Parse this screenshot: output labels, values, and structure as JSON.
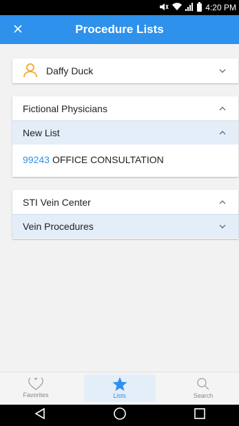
{
  "status_bar": {
    "time": "4:20 PM"
  },
  "header": {
    "title": "Procedure Lists"
  },
  "patient": {
    "name": "Daffy Duck"
  },
  "groups": [
    {
      "title": "Fictional Physicians",
      "list_title": "New List",
      "items": [
        {
          "code": "99243",
          "description": "OFFICE CONSULTATION"
        }
      ]
    },
    {
      "title": "STI Vein Center",
      "list_title": "Vein Procedures"
    }
  ],
  "bottom_nav": {
    "favorites": "Favorites",
    "lists": "Lists",
    "search": "Search"
  },
  "colors": {
    "accent": "#2e91ec",
    "avatar": "#f5a623",
    "sublist_bg": "#e3eef9"
  }
}
